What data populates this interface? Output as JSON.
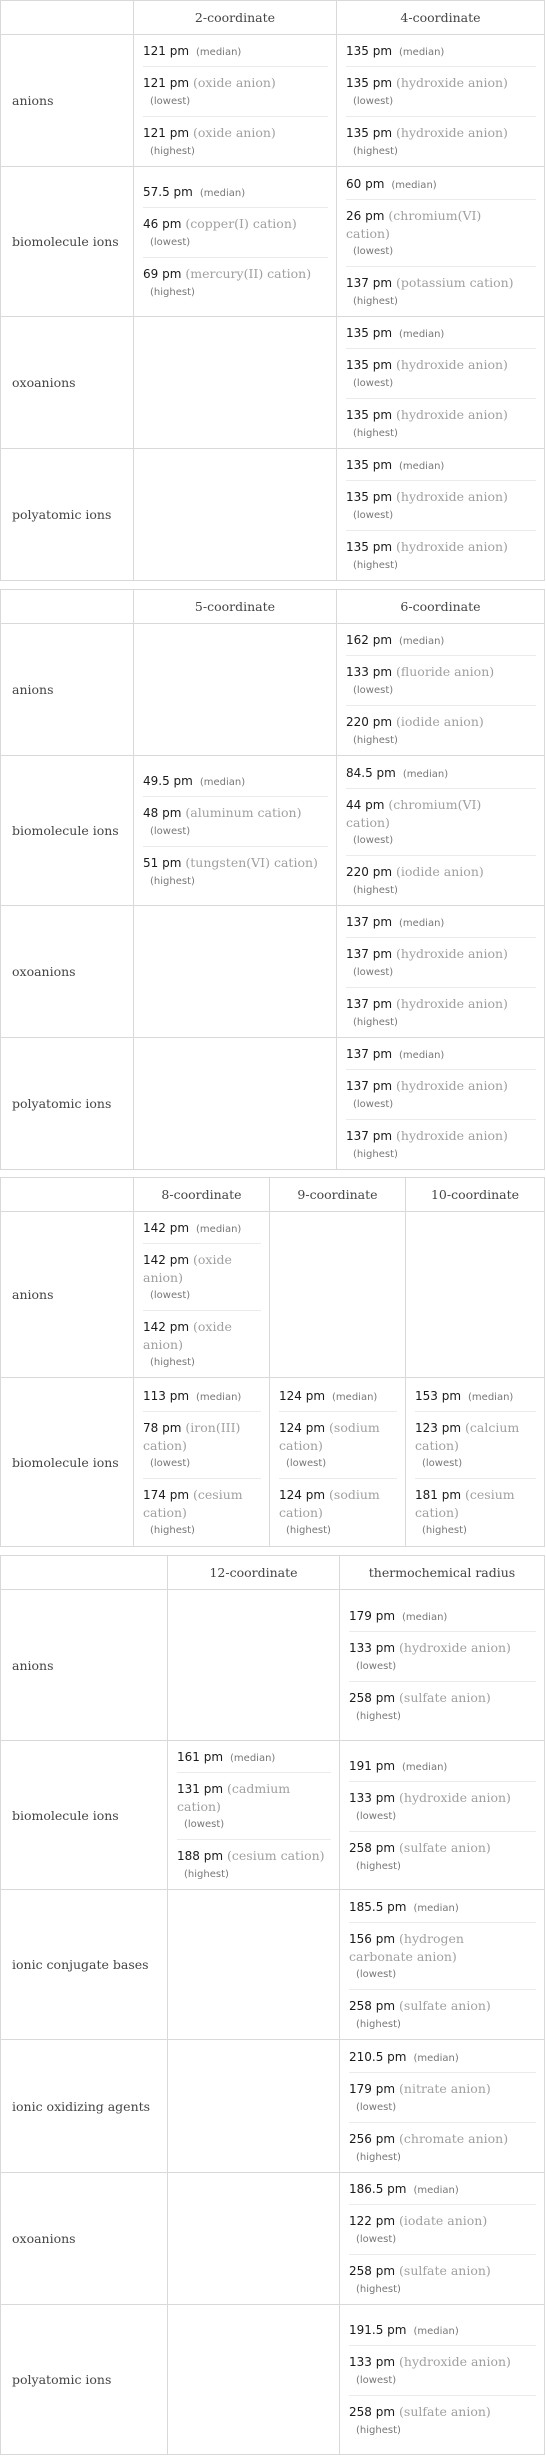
{
  "labels": {
    "median": "(median)",
    "lowest": "(lowest)",
    "highest": "(highest)"
  },
  "tables": [
    {
      "columns": [
        "2-coordinate",
        "4-coordinate"
      ],
      "rows": [
        {
          "label": "anions",
          "cells": [
            {
              "median": "121 pm",
              "lowest": {
                "value": "121 pm",
                "ion": "(oxide anion)"
              },
              "highest": {
                "value": "121 pm",
                "ion": "(oxide anion)"
              }
            },
            {
              "median": "135 pm",
              "lowest": {
                "value": "135 pm",
                "ion": "(hydroxide anion)"
              },
              "highest": {
                "value": "135 pm",
                "ion": "(hydroxide anion)"
              }
            }
          ]
        },
        {
          "label": "biomolecule ions",
          "cells": [
            {
              "median": "57.5 pm",
              "lowest": {
                "value": "46 pm",
                "ion": "(copper(I) cation)"
              },
              "highest": {
                "value": "69 pm",
                "ion": "(mercury(II) cation)"
              }
            },
            {
              "median": "60 pm",
              "lowest": {
                "value": "26 pm",
                "ion": "(chromium(VI) cation)"
              },
              "highest": {
                "value": "137 pm",
                "ion": "(potassium cation)"
              }
            }
          ]
        },
        {
          "label": "oxoanions",
          "cells": [
            null,
            {
              "median": "135 pm",
              "lowest": {
                "value": "135 pm",
                "ion": "(hydroxide anion)"
              },
              "highest": {
                "value": "135 pm",
                "ion": "(hydroxide anion)"
              }
            }
          ]
        },
        {
          "label": "polyatomic ions",
          "cells": [
            null,
            {
              "median": "135 pm",
              "lowest": {
                "value": "135 pm",
                "ion": "(hydroxide anion)"
              },
              "highest": {
                "value": "135 pm",
                "ion": "(hydroxide anion)"
              }
            }
          ]
        }
      ]
    },
    {
      "columns": [
        "5-coordinate",
        "6-coordinate"
      ],
      "rows": [
        {
          "label": "anions",
          "cells": [
            null,
            {
              "median": "162 pm",
              "lowest": {
                "value": "133 pm",
                "ion": "(fluoride anion)"
              },
              "highest": {
                "value": "220 pm",
                "ion": "(iodide anion)"
              }
            }
          ]
        },
        {
          "label": "biomolecule ions",
          "cells": [
            {
              "median": "49.5 pm",
              "lowest": {
                "value": "48 pm",
                "ion": "(aluminum cation)"
              },
              "highest": {
                "value": "51 pm",
                "ion": "(tungsten(VI) cation)"
              }
            },
            {
              "median": "84.5 pm",
              "lowest": {
                "value": "44 pm",
                "ion": "(chromium(VI) cation)"
              },
              "highest": {
                "value": "220 pm",
                "ion": "(iodide anion)"
              }
            }
          ]
        },
        {
          "label": "oxoanions",
          "cells": [
            null,
            {
              "median": "137 pm",
              "lowest": {
                "value": "137 pm",
                "ion": "(hydroxide anion)"
              },
              "highest": {
                "value": "137 pm",
                "ion": "(hydroxide anion)"
              }
            }
          ]
        },
        {
          "label": "polyatomic ions",
          "cells": [
            null,
            {
              "median": "137 pm",
              "lowest": {
                "value": "137 pm",
                "ion": "(hydroxide anion)"
              },
              "highest": {
                "value": "137 pm",
                "ion": "(hydroxide anion)"
              }
            }
          ]
        }
      ]
    },
    {
      "columns": [
        "8-coordinate",
        "9-coordinate",
        "10-coordinate"
      ],
      "rows": [
        {
          "label": "anions",
          "cells": [
            {
              "median": "142 pm",
              "lowest": {
                "value": "142 pm",
                "ion": "(oxide anion)"
              },
              "highest": {
                "value": "142 pm",
                "ion": "(oxide anion)"
              }
            },
            null,
            null
          ]
        },
        {
          "label": "biomolecule ions",
          "cells": [
            {
              "median": "113 pm",
              "lowest": {
                "value": "78 pm",
                "ion": "(iron(III) cation)"
              },
              "highest": {
                "value": "174 pm",
                "ion": "(cesium cation)"
              }
            },
            {
              "median": "124 pm",
              "lowest": {
                "value": "124 pm",
                "ion": "(sodium cation)"
              },
              "highest": {
                "value": "124 pm",
                "ion": "(sodium cation)"
              }
            },
            {
              "median": "153 pm",
              "lowest": {
                "value": "123 pm",
                "ion": "(calcium cation)"
              },
              "highest": {
                "value": "181 pm",
                "ion": "(cesium cation)"
              }
            }
          ]
        }
      ]
    },
    {
      "columns": [
        "12-coordinate",
        "thermochemical radius"
      ],
      "rows": [
        {
          "label": "anions",
          "cells": [
            null,
            {
              "median": "179 pm",
              "lowest": {
                "value": "133 pm",
                "ion": "(hydroxide anion)"
              },
              "highest": {
                "value": "258 pm",
                "ion": "(sulfate anion)"
              }
            }
          ]
        },
        {
          "label": "biomolecule ions",
          "cells": [
            {
              "median": "161 pm",
              "lowest": {
                "value": "131 pm",
                "ion": "(cadmium cation)"
              },
              "highest": {
                "value": "188 pm",
                "ion": "(cesium cation)"
              }
            },
            {
              "median": "191 pm",
              "lowest": {
                "value": "133 pm",
                "ion": "(hydroxide anion)"
              },
              "highest": {
                "value": "258 pm",
                "ion": "(sulfate anion)"
              }
            }
          ]
        },
        {
          "label": "ionic conjugate bases",
          "cells": [
            null,
            {
              "median": "185.5 pm",
              "lowest": {
                "value": "156 pm",
                "ion": "(hydrogen carbonate anion)"
              },
              "highest": {
                "value": "258 pm",
                "ion": "(sulfate anion)"
              }
            }
          ]
        },
        {
          "label": "ionic oxidizing agents",
          "cells": [
            null,
            {
              "median": "210.5 pm",
              "lowest": {
                "value": "179 pm",
                "ion": "(nitrate anion)"
              },
              "highest": {
                "value": "256 pm",
                "ion": "(chromate anion)"
              }
            }
          ]
        },
        {
          "label": "oxoanions",
          "cells": [
            null,
            {
              "median": "186.5 pm",
              "lowest": {
                "value": "122 pm",
                "ion": "(iodate anion)"
              },
              "highest": {
                "value": "258 pm",
                "ion": "(sulfate anion)"
              }
            }
          ]
        },
        {
          "label": "polyatomic ions",
          "cells": [
            null,
            {
              "median": "191.5 pm",
              "lowest": {
                "value": "133 pm",
                "ion": "(hydroxide anion)"
              },
              "highest": {
                "value": "258 pm",
                "ion": "(sulfate anion)"
              }
            }
          ]
        }
      ]
    }
  ]
}
